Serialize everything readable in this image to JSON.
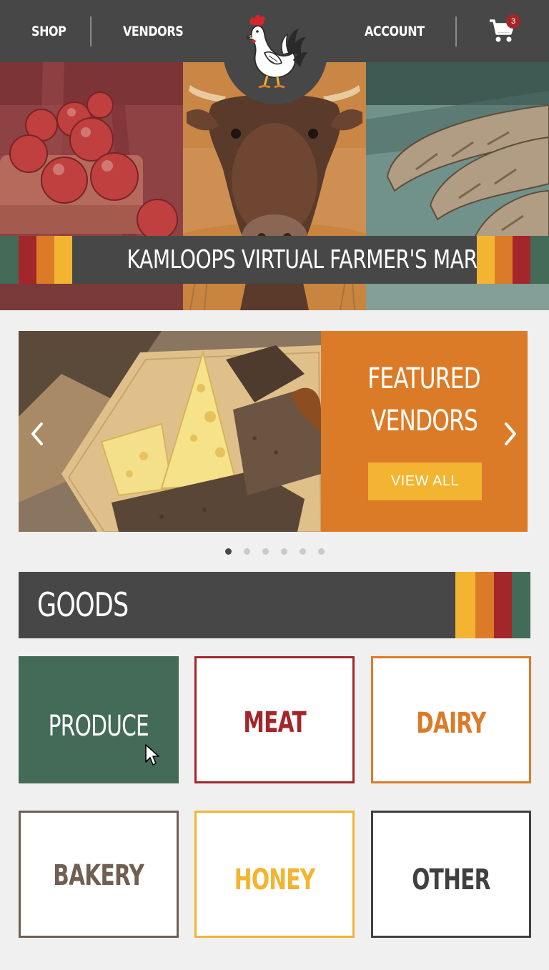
{
  "nav": {
    "shop_label": "SHOP",
    "vendors_label": "VENDORS",
    "account_label": "ACCOUNT",
    "cart_count": "3",
    "logo_icon": "rooster-logo-icon",
    "cart_icon": "shopping-cart-icon"
  },
  "hero": {
    "title": "KAMLOOPS VIRTUAL FARMER'S MARKET",
    "panels": [
      "apples",
      "cow",
      "bread"
    ]
  },
  "featured": {
    "line1": "FEATURED",
    "line2": "VENDORS",
    "button_label": "VIEW ALL",
    "slide_count": 6,
    "active_slide": 1
  },
  "goods": {
    "title": "GOODS",
    "categories": [
      {
        "label": "PRODUCE",
        "color": "#436b58",
        "selected": true
      },
      {
        "label": "MEAT",
        "color": "#a3262a",
        "selected": false
      },
      {
        "label": "DAIRY",
        "color": "#dc7b27",
        "selected": false
      },
      {
        "label": "BAKERY",
        "color": "#705f52",
        "selected": false
      },
      {
        "label": "HONEY",
        "color": "#f2b431",
        "selected": false
      },
      {
        "label": "OTHER",
        "color": "#404040",
        "selected": false
      }
    ]
  },
  "colors": {
    "nav_bg": "#474747",
    "green": "#436b58",
    "red": "#a3262a",
    "orange": "#dc7b27",
    "yellow": "#f2b431",
    "page_bg": "#f0f0f0"
  }
}
